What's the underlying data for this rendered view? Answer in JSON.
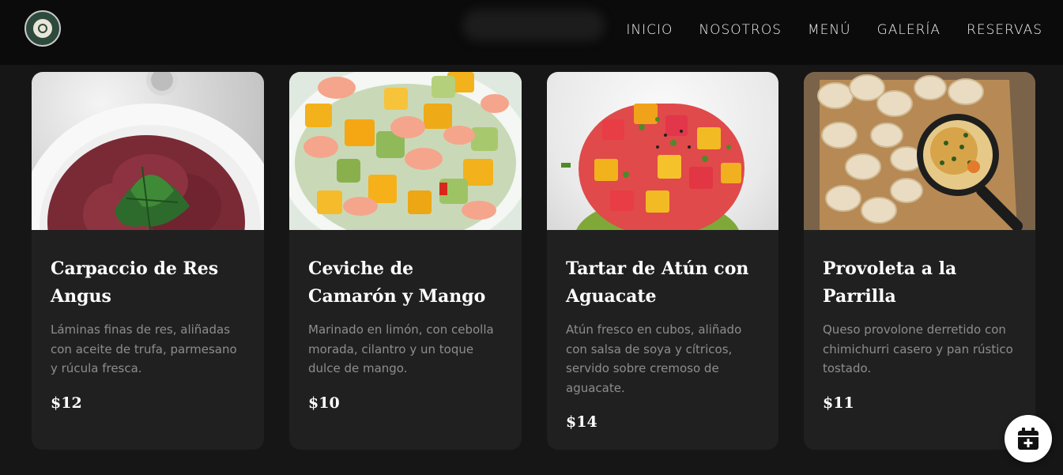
{
  "nav": {
    "items": [
      "INICIO",
      "NOSOTROS",
      "MENÚ",
      "GALERÍA",
      "RESERVAS"
    ]
  },
  "dishes": [
    {
      "name": "Carpaccio de Res Angus",
      "description": "Láminas finas de res, aliñadas con aceite de trufa, parmesano y rúcula fresca.",
      "price": "$12"
    },
    {
      "name": "Ceviche de Camarón y Mango",
      "description": "Marinado en limón, con cebolla morada, cilantro y un toque dulce de mango.",
      "price": "$10"
    },
    {
      "name": "Tartar de Atún con Aguacate",
      "description": "Atún fresco en cubos, aliñado con salsa de soya y cítricos, servido sobre cremoso de aguacate.",
      "price": "$14"
    },
    {
      "name": "Provoleta a la Parrilla",
      "description": "Queso provolone derretido con chimichurri casero y pan rústico tostado.",
      "price": "$11"
    }
  ],
  "icons": {
    "logo": "restaurant-logo-icon",
    "fab": "calendar-plus-icon"
  },
  "colors": {
    "background": "#161616",
    "header": "#0b0b0b",
    "card": "#202020",
    "text_muted": "#8d8d8d"
  }
}
